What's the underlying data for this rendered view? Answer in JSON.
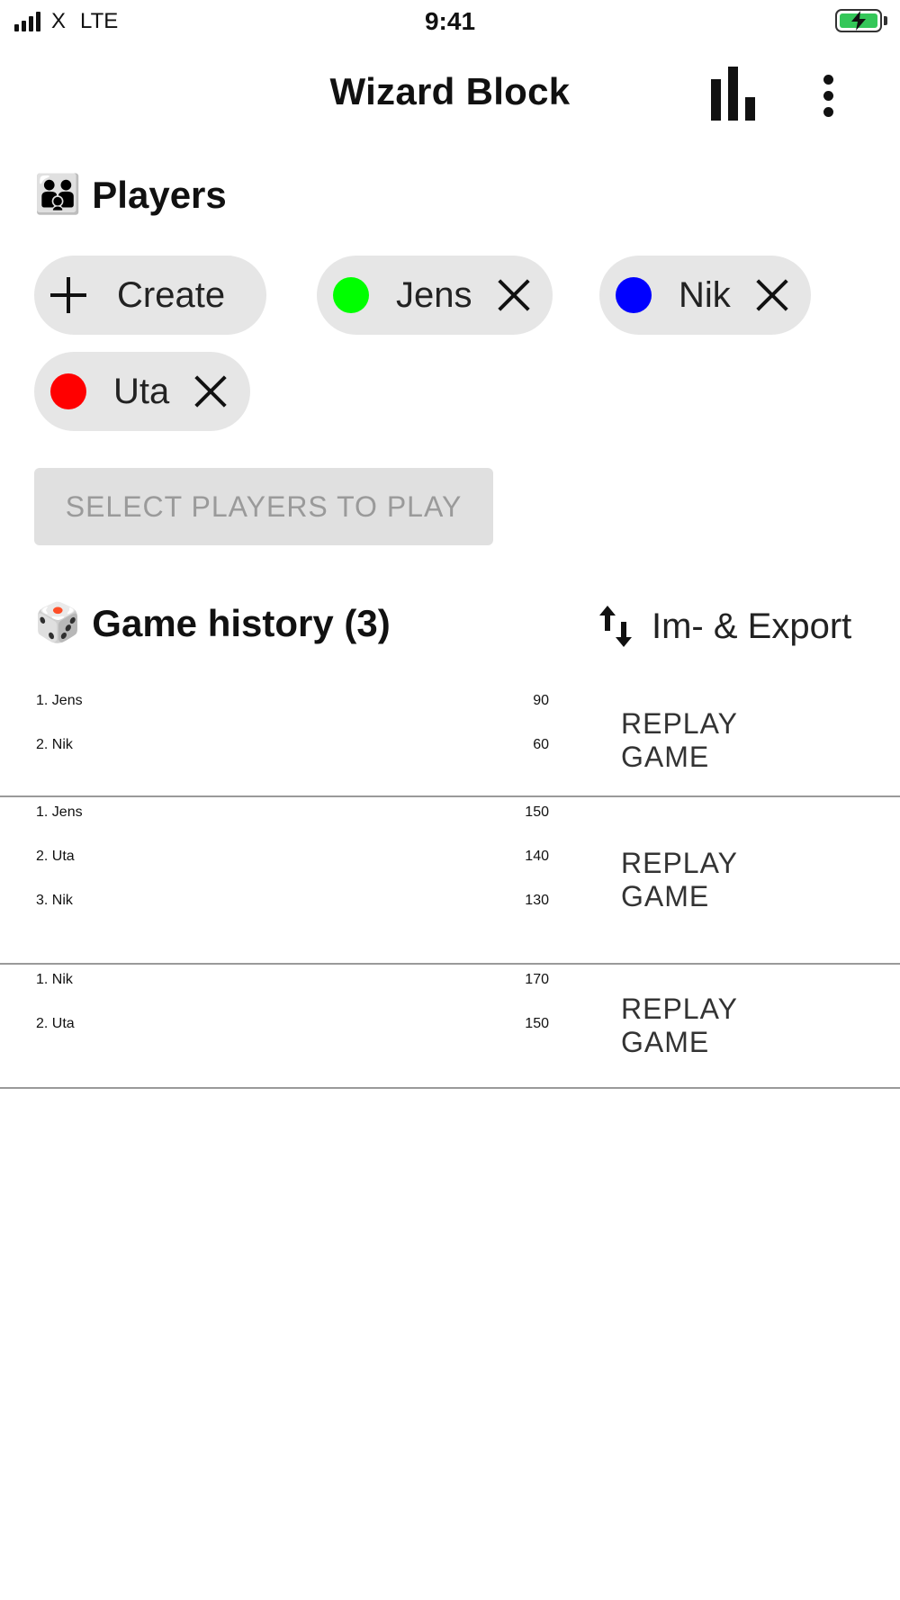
{
  "status_bar": {
    "carrier": "X",
    "network": "LTE",
    "time": "9:41",
    "battery_icon": "battery-charging-icon",
    "signal_icon": "signal-bars-icon"
  },
  "app_bar": {
    "title": "Wizard Block",
    "stats_icon": "bar-chart-icon",
    "menu_icon": "more-vertical-icon"
  },
  "players": {
    "title": "Players",
    "icon": "👪",
    "create_label": "Create",
    "items": [
      {
        "name": "Jens",
        "color": "#00ff00"
      },
      {
        "name": "Nik",
        "color": "#0000ff"
      },
      {
        "name": "Uta",
        "color": "#ff0000"
      }
    ],
    "play_button_label": "SELECT PLAYERS TO PLAY"
  },
  "history": {
    "title": "Game history (3)",
    "icon": "🎲",
    "export_label": "Im- & Export",
    "replay_label": "REPLAY GAME",
    "games": [
      {
        "results": [
          {
            "name": "1. Jens",
            "score": "90"
          },
          {
            "name": "2. Nik",
            "score": "60"
          }
        ]
      },
      {
        "results": [
          {
            "name": "1. Jens",
            "score": "150"
          },
          {
            "name": "2. Uta",
            "score": "140"
          },
          {
            "name": "3. Nik",
            "score": "130"
          }
        ]
      },
      {
        "results": [
          {
            "name": "1. Nik",
            "score": "170"
          },
          {
            "name": "2. Uta",
            "score": "150"
          }
        ]
      }
    ]
  }
}
